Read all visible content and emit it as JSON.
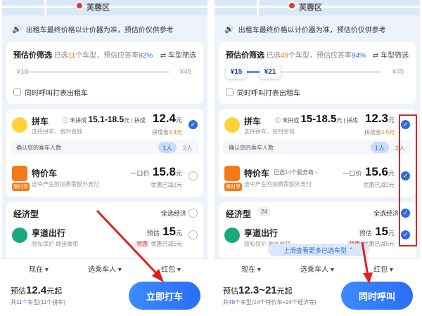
{
  "left": {
    "map": {
      "district": "芙蓉区"
    },
    "notice": "出租车最终价格以计价器为准，预估价仅供参考",
    "filter": {
      "title": "预估价筛选",
      "selected_prefix": "已选",
      "selected_count": "11",
      "selected_suffix": "个车型，预估应答率",
      "rate": "92%",
      "type_filter": "车型筛选",
      "min": "¥15",
      "max": "¥45",
      "taxi_label": "同时呼叫打表出租车"
    },
    "pinche": {
      "name": "拼车",
      "sub": "选择拼车，省时省钱",
      "range_prefix": "未拼成",
      "range": "15.1-18.5",
      "yuan": "元",
      "sep": "拼成",
      "price": "12.4",
      "note_prefix": "拼成省",
      "saving": "4.4元",
      "seat_question": "确认您的乘车人数",
      "seat1": "1人",
      "seat2": "2人"
    },
    "special": {
      "name": "特价车",
      "sub": "途中产生附加费需额外支付",
      "label": "一口价",
      "price": "15.8",
      "unit": "元",
      "note": "优惠已减2元",
      "tag": "限时享"
    },
    "econ": {
      "title": "经济型",
      "selall": "全选经济",
      "item": {
        "name": "享道出行",
        "sub": "隐私保护  敢坐敢租",
        "label": "预估",
        "price": "15",
        "unit": "元",
        "special": "特惠",
        "note": "优惠已减5元"
      }
    },
    "tabs": [
      "现在",
      "选乘车人",
      "红包"
    ],
    "estimate": {
      "prefix": "预估",
      "price": "12.4",
      "suffix": "元起"
    },
    "estimate_sub": {
      "a": "共",
      "count": "11",
      "b": "个车型(11个拼车)"
    },
    "cta": "立即打车"
  },
  "right": {
    "map": {
      "district": "芙蓉区"
    },
    "notice": "出租车最终价格以计价器为准，预估价仅供参考",
    "filter": {
      "title": "预估价筛选",
      "selected_prefix": "已选",
      "selected_count": "49",
      "selected_suffix": "个车型，预估应答率",
      "rate": "94%",
      "type_filter": "车型筛选",
      "min": "¥15",
      "mid": "¥21",
      "max": "¥45",
      "taxi_label": "同时呼叫打表出租车"
    },
    "pinche": {
      "name": "拼车",
      "sub": "选择拼车，省时省钱",
      "range_prefix": "未拼成",
      "range": "15-18.5",
      "yuan": "元",
      "sep": "拼成",
      "price": "12.3",
      "note_prefix": "拼成省",
      "saving": "4.5元",
      "seat_question": "确认您的乘车人数",
      "seat1": "1人",
      "seat2": "2人"
    },
    "special": {
      "name": "特价车",
      "service_prefix": "已选",
      "service_count": "14",
      "service_suffix": "个服务商",
      "sub": "途中产生附加费需额外支付",
      "label": "一口价",
      "price": "15.6",
      "unit": "元",
      "note": "优惠已减2元",
      "tag": "限时享"
    },
    "econ": {
      "title": "经济型",
      "count": "24",
      "selall": "全选经济",
      "item": {
        "name": "享道出行",
        "sub": "隐私保护  敢坐敢租",
        "label": "预估",
        "price": "15",
        "unit": "元",
        "special": "特惠",
        "note": "优惠已减5元"
      }
    },
    "scroll_hint": "上滑查看更多已选车型",
    "tabs": [
      "现在",
      "选乘车人",
      "红包"
    ],
    "estimate": {
      "prefix": "预估",
      "price": "12.3~21",
      "suffix": "元起"
    },
    "estimate_sub": {
      "a": "共",
      "count": "49",
      "b": "个车型(14个特价车+24个经济等)"
    },
    "cta": "同时呼叫"
  },
  "colors": {
    "accent": "#2f6bdb",
    "orange": "#f27a1a",
    "annotation": "#d02525"
  }
}
